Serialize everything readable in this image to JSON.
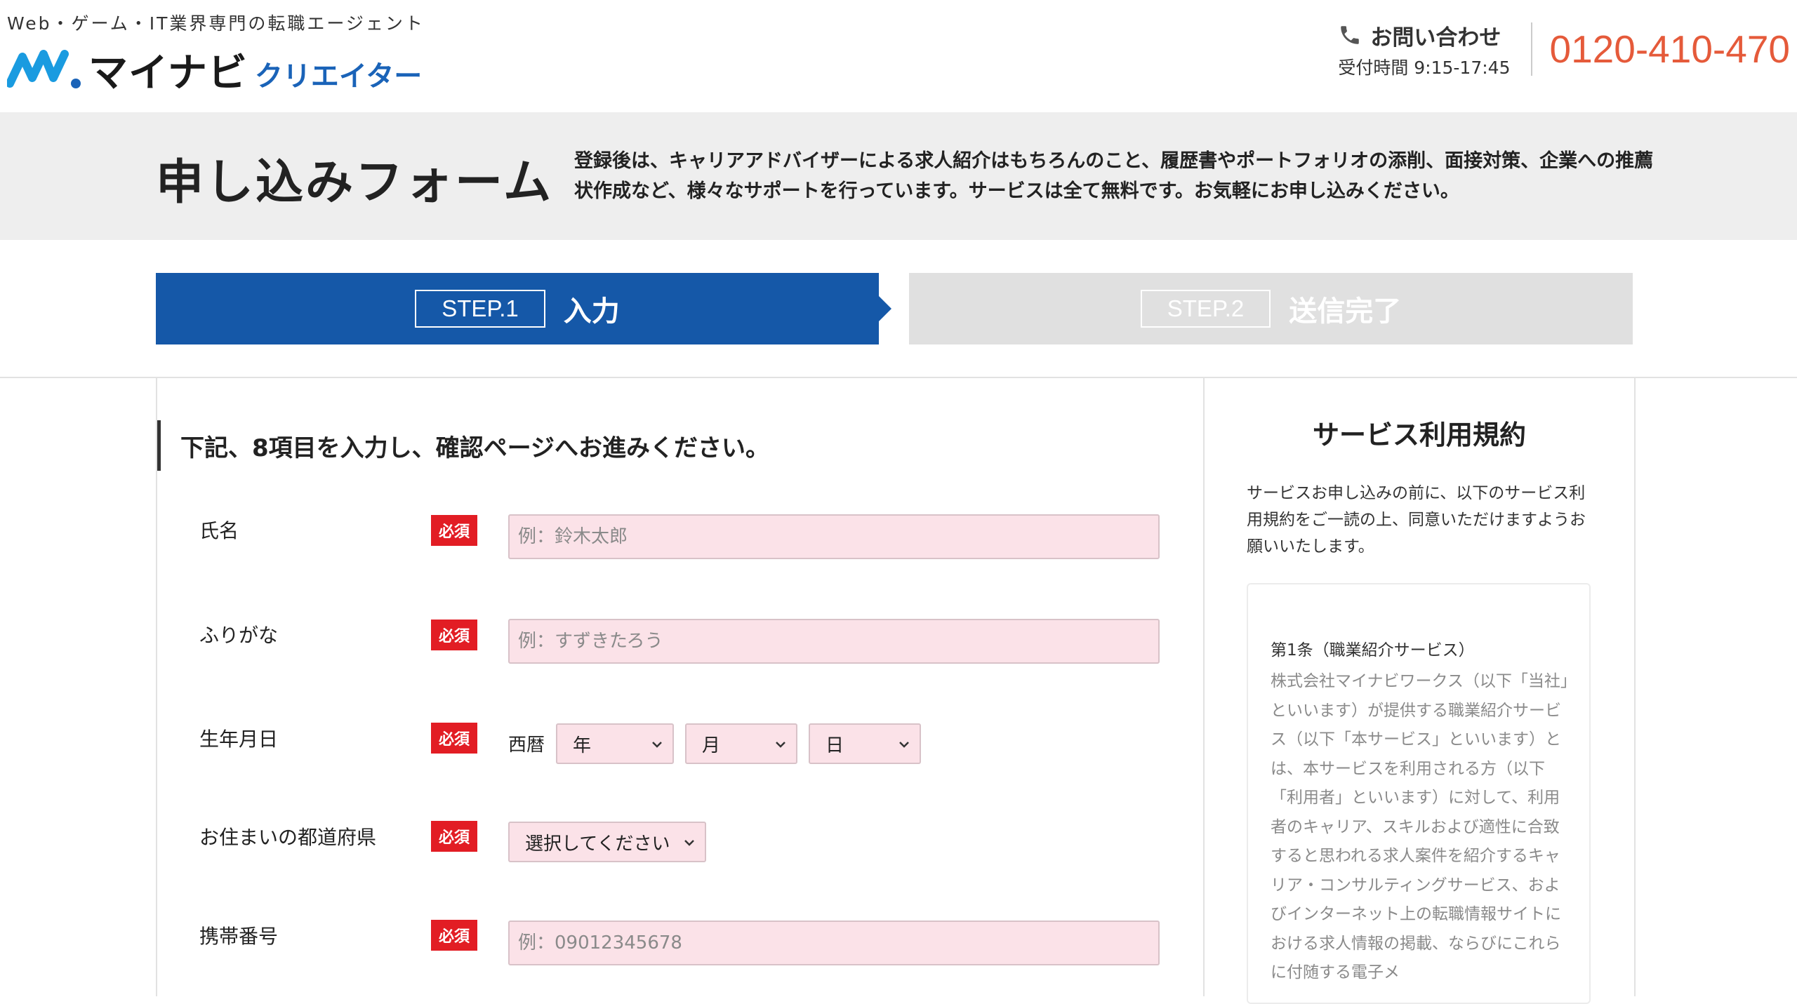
{
  "header": {
    "tagline": "Web・ゲーム・IT業界専門の転職エージェント",
    "logo_main": "マイナビ",
    "logo_sub": "クリエイター",
    "contact_title": "お問い合わせ",
    "contact_hours": "受付時間 9:15-17:45",
    "contact_phone": "0120-410-470",
    "colors": {
      "brand_blue": "#1558a8",
      "phone_orange": "#e55a3a"
    }
  },
  "hero": {
    "title": "申し込みフォーム",
    "description": "登録後は、キャリアアドバイザーによる求人紹介はもちろんのこと、履歴書やポートフォリオの添削、面接対策、企業への推薦状作成など、様々なサポートを行っています。サービスは全て無料です。お気軽にお申し込みください。"
  },
  "steps": [
    {
      "number": "STEP.1",
      "label": "入力",
      "active": true
    },
    {
      "number": "STEP.2",
      "label": "送信完了",
      "active": false
    }
  ],
  "form": {
    "heading": "下記、8項目を入力し、確認ページへお進みください。",
    "required_badge": "必須",
    "fields": {
      "name": {
        "label": "氏名",
        "placeholder": "例：鈴木太郎",
        "value": ""
      },
      "furigana": {
        "label": "ふりがな",
        "placeholder": "例：すずきたろう",
        "value": ""
      },
      "birthdate": {
        "label": "生年月日",
        "era": "西暦",
        "year": "年",
        "month": "月",
        "day": "日"
      },
      "prefecture": {
        "label": "お住まいの都道府県",
        "selected": "選択してください"
      },
      "mobile": {
        "label": "携帯番号",
        "placeholder": "例：09012345678",
        "value": ""
      }
    }
  },
  "terms": {
    "title": "サービス利用規約",
    "intro": "サービスお申し込みの前に、以下のサービス利用規約をご一読の上、同意いただけますようお願いいたします。",
    "article_title": "第1条（職業紹介サービス）",
    "article_body": "株式会社マイナビワークス（以下「当社」といいます）が提供する職業紹介サービス（以下「本サービス」といいます）とは、本サービスを利用される方（以下「利用者」といいます）に対して、利用者のキャリア、スキルおよび適性に合致すると思われる求人案件を紹介するキャリア・コンサルティングサービス、およびインターネット上の転職情報サイトにおける求人情報の掲載、ならびにこれらに付随する電子メ"
  }
}
